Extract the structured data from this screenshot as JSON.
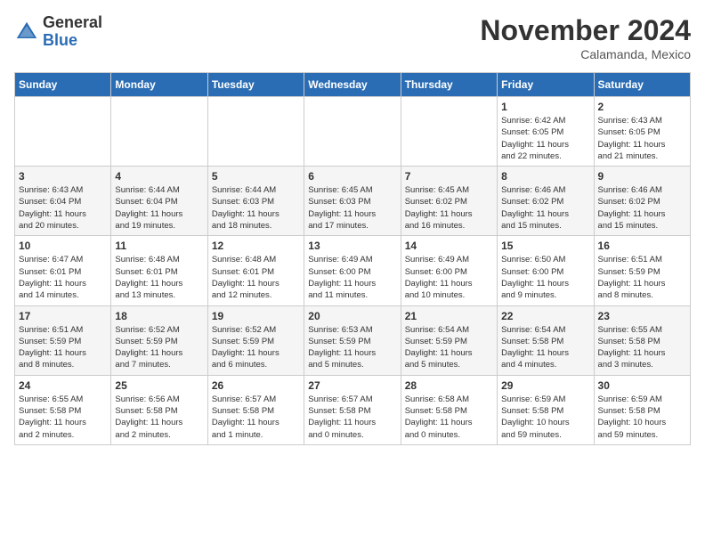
{
  "logo": {
    "general": "General",
    "blue": "Blue"
  },
  "title": "November 2024",
  "location": "Calamanda, Mexico",
  "days_header": [
    "Sunday",
    "Monday",
    "Tuesday",
    "Wednesday",
    "Thursday",
    "Friday",
    "Saturday"
  ],
  "weeks": [
    [
      {
        "day": "",
        "info": ""
      },
      {
        "day": "",
        "info": ""
      },
      {
        "day": "",
        "info": ""
      },
      {
        "day": "",
        "info": ""
      },
      {
        "day": "",
        "info": ""
      },
      {
        "day": "1",
        "info": "Sunrise: 6:42 AM\nSunset: 6:05 PM\nDaylight: 11 hours\nand 22 minutes."
      },
      {
        "day": "2",
        "info": "Sunrise: 6:43 AM\nSunset: 6:05 PM\nDaylight: 11 hours\nand 21 minutes."
      }
    ],
    [
      {
        "day": "3",
        "info": "Sunrise: 6:43 AM\nSunset: 6:04 PM\nDaylight: 11 hours\nand 20 minutes."
      },
      {
        "day": "4",
        "info": "Sunrise: 6:44 AM\nSunset: 6:04 PM\nDaylight: 11 hours\nand 19 minutes."
      },
      {
        "day": "5",
        "info": "Sunrise: 6:44 AM\nSunset: 6:03 PM\nDaylight: 11 hours\nand 18 minutes."
      },
      {
        "day": "6",
        "info": "Sunrise: 6:45 AM\nSunset: 6:03 PM\nDaylight: 11 hours\nand 17 minutes."
      },
      {
        "day": "7",
        "info": "Sunrise: 6:45 AM\nSunset: 6:02 PM\nDaylight: 11 hours\nand 16 minutes."
      },
      {
        "day": "8",
        "info": "Sunrise: 6:46 AM\nSunset: 6:02 PM\nDaylight: 11 hours\nand 15 minutes."
      },
      {
        "day": "9",
        "info": "Sunrise: 6:46 AM\nSunset: 6:02 PM\nDaylight: 11 hours\nand 15 minutes."
      }
    ],
    [
      {
        "day": "10",
        "info": "Sunrise: 6:47 AM\nSunset: 6:01 PM\nDaylight: 11 hours\nand 14 minutes."
      },
      {
        "day": "11",
        "info": "Sunrise: 6:48 AM\nSunset: 6:01 PM\nDaylight: 11 hours\nand 13 minutes."
      },
      {
        "day": "12",
        "info": "Sunrise: 6:48 AM\nSunset: 6:01 PM\nDaylight: 11 hours\nand 12 minutes."
      },
      {
        "day": "13",
        "info": "Sunrise: 6:49 AM\nSunset: 6:00 PM\nDaylight: 11 hours\nand 11 minutes."
      },
      {
        "day": "14",
        "info": "Sunrise: 6:49 AM\nSunset: 6:00 PM\nDaylight: 11 hours\nand 10 minutes."
      },
      {
        "day": "15",
        "info": "Sunrise: 6:50 AM\nSunset: 6:00 PM\nDaylight: 11 hours\nand 9 minutes."
      },
      {
        "day": "16",
        "info": "Sunrise: 6:51 AM\nSunset: 5:59 PM\nDaylight: 11 hours\nand 8 minutes."
      }
    ],
    [
      {
        "day": "17",
        "info": "Sunrise: 6:51 AM\nSunset: 5:59 PM\nDaylight: 11 hours\nand 8 minutes."
      },
      {
        "day": "18",
        "info": "Sunrise: 6:52 AM\nSunset: 5:59 PM\nDaylight: 11 hours\nand 7 minutes."
      },
      {
        "day": "19",
        "info": "Sunrise: 6:52 AM\nSunset: 5:59 PM\nDaylight: 11 hours\nand 6 minutes."
      },
      {
        "day": "20",
        "info": "Sunrise: 6:53 AM\nSunset: 5:59 PM\nDaylight: 11 hours\nand 5 minutes."
      },
      {
        "day": "21",
        "info": "Sunrise: 6:54 AM\nSunset: 5:59 PM\nDaylight: 11 hours\nand 5 minutes."
      },
      {
        "day": "22",
        "info": "Sunrise: 6:54 AM\nSunset: 5:58 PM\nDaylight: 11 hours\nand 4 minutes."
      },
      {
        "day": "23",
        "info": "Sunrise: 6:55 AM\nSunset: 5:58 PM\nDaylight: 11 hours\nand 3 minutes."
      }
    ],
    [
      {
        "day": "24",
        "info": "Sunrise: 6:55 AM\nSunset: 5:58 PM\nDaylight: 11 hours\nand 2 minutes."
      },
      {
        "day": "25",
        "info": "Sunrise: 6:56 AM\nSunset: 5:58 PM\nDaylight: 11 hours\nand 2 minutes."
      },
      {
        "day": "26",
        "info": "Sunrise: 6:57 AM\nSunset: 5:58 PM\nDaylight: 11 hours\nand 1 minute."
      },
      {
        "day": "27",
        "info": "Sunrise: 6:57 AM\nSunset: 5:58 PM\nDaylight: 11 hours\nand 0 minutes."
      },
      {
        "day": "28",
        "info": "Sunrise: 6:58 AM\nSunset: 5:58 PM\nDaylight: 11 hours\nand 0 minutes."
      },
      {
        "day": "29",
        "info": "Sunrise: 6:59 AM\nSunset: 5:58 PM\nDaylight: 10 hours\nand 59 minutes."
      },
      {
        "day": "30",
        "info": "Sunrise: 6:59 AM\nSunset: 5:58 PM\nDaylight: 10 hours\nand 59 minutes."
      }
    ]
  ]
}
